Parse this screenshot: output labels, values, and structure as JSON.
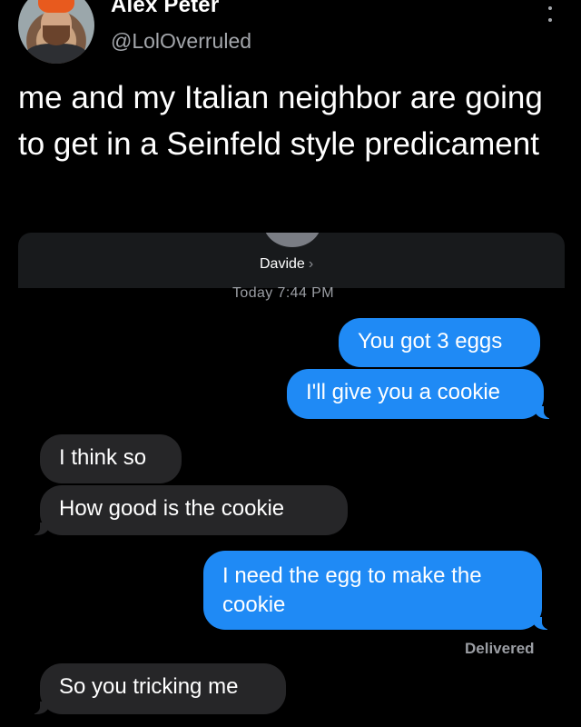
{
  "tweet": {
    "author_name": "Alex Peter",
    "handle": "@LolOverruled",
    "text": "me and my Italian neighbor are going to get in a Seinfeld style predicament"
  },
  "conversation": {
    "contact_name": "Davide",
    "timestamp": "Today 7:44 PM",
    "delivered_label": "Delivered",
    "messages": [
      {
        "from": "me",
        "text": "You got 3 eggs"
      },
      {
        "from": "me",
        "text": "I'll give you a cookie"
      },
      {
        "from": "them",
        "text": "I think so"
      },
      {
        "from": "them",
        "text": "How good  is the cookie"
      },
      {
        "from": "me",
        "text": "I need the egg to make the cookie"
      },
      {
        "from": "them",
        "text": "So you tricking me"
      }
    ]
  },
  "colors": {
    "outgoing_bubble": "#1f8af5",
    "incoming_bubble": "#262628",
    "background": "#000000",
    "muted_text": "#a3a6ab"
  },
  "icons": {
    "more": "more-vertical-icon",
    "chevron": "chevron-right-icon"
  }
}
